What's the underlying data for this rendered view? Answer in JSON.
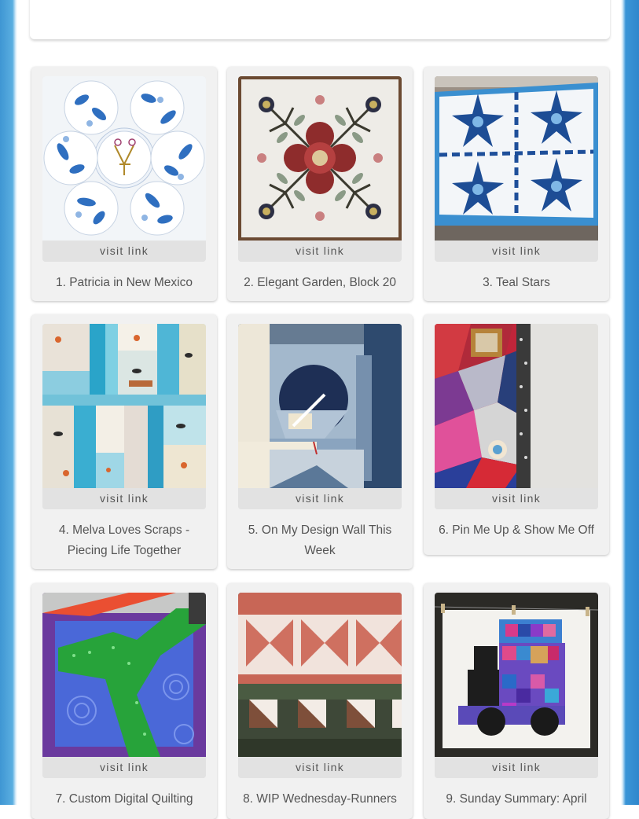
{
  "links": [
    {
      "visit_label": "visit link",
      "caption": "1. Patricia in New Mexico",
      "thumb_icon": "blue-floral-hexagon-quilt"
    },
    {
      "visit_label": "visit link",
      "caption": "2. Elegant Garden, Block 20",
      "thumb_icon": "applique-flower-block"
    },
    {
      "visit_label": "visit link",
      "caption": "3. Teal Stars",
      "thumb_icon": "teal-stars-quilt"
    },
    {
      "visit_label": "visit link",
      "caption": "4. Melva Loves Scraps - Piecing Life Together",
      "thumb_icon": "scrappy-log-cabin-blocks"
    },
    {
      "visit_label": "visit link",
      "caption": "5. On My Design Wall This Week",
      "thumb_icon": "blue-improv-quilt"
    },
    {
      "visit_label": "visit link",
      "caption": "6. Pin Me Up & Show Me Off",
      "thumb_icon": "crazy-quilt-wall"
    },
    {
      "visit_label": "visit link",
      "caption": "7. Custom Digital Quilting",
      "thumb_icon": "purple-quilting-frame"
    },
    {
      "visit_label": "visit link",
      "caption": "8. WIP Wednesday-Runners",
      "thumb_icon": "pink-green-runners"
    },
    {
      "visit_label": "visit link",
      "caption": "9. Sunday Summary: April",
      "thumb_icon": "train-quilt"
    }
  ]
}
